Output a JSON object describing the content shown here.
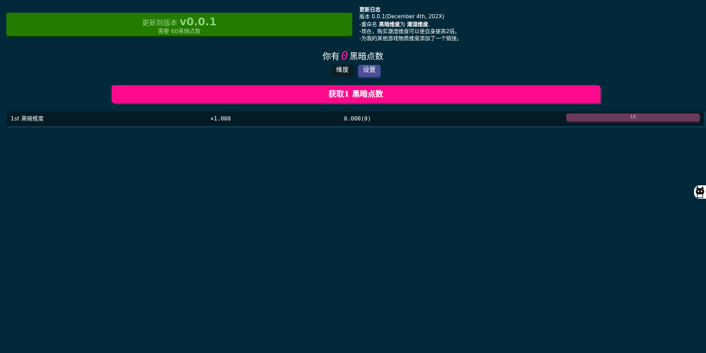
{
  "update": {
    "title_prefix": "更新到版本",
    "version": "v0.0.1",
    "cost": "需要 60黑暗点数"
  },
  "changelog": {
    "title": "更新日志",
    "version_line": "版本 0.0.1(December 4th, 202X)",
    "line1_prefix": "-重命名 ",
    "line1_from": "黑暗维度",
    "line1_mid": "为 ",
    "line1_to": "潮湿维度",
    "line1_end": ".",
    "line2": "-现在，购买潮湿维度可以使自身提高2倍。",
    "line3": "-为我的其他游戏物质维度添加了一个链接。"
  },
  "points": {
    "prefix": "你有",
    "amount": "0",
    "suffix": "黑暗点数"
  },
  "tabs": {
    "dimensions": "维度",
    "settings": "设置"
  },
  "main_button": {
    "label": "获取1 黑暗点数"
  },
  "dimension_row": {
    "name": "1st 黑暗维度",
    "multiplier": "×1.000",
    "amount": "0.000(0)",
    "cost": "10"
  },
  "colors": {
    "background": "#01293a",
    "update_button": "#237b00",
    "main_button": "#ff0a8c",
    "points_amount": "#ff1a9e",
    "settings_tab": "#4b4f95",
    "buy_button": "#6b3b5e"
  },
  "icons": {
    "avatar": "cat-avatar-icon"
  }
}
